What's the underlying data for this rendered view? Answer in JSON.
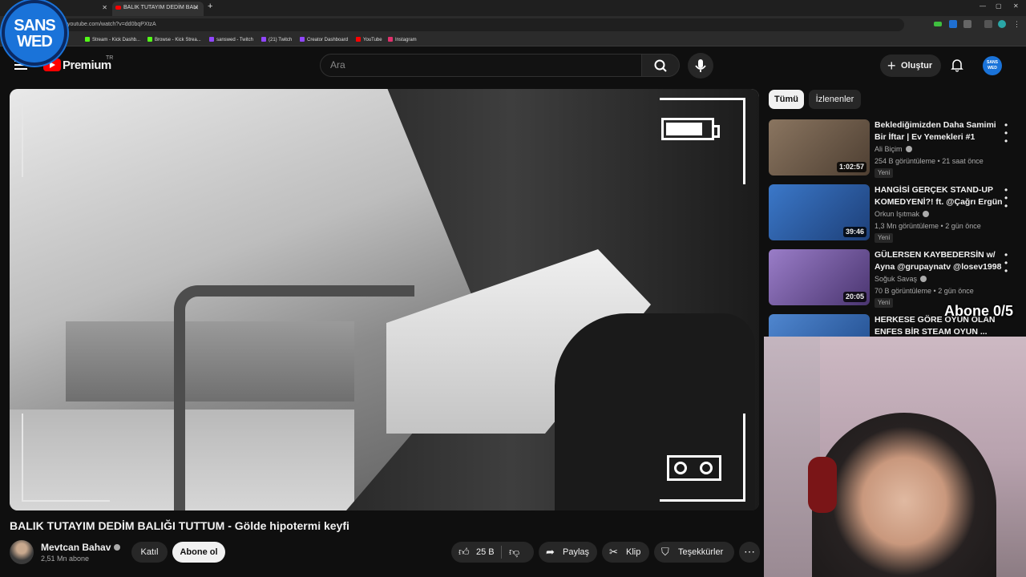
{
  "browser": {
    "tab1_label": "",
    "tab2_label": "BALIK TUTAYIM DEDİM BALI",
    "url": "youtube.com/watch?v=dd0bqPXtzA",
    "bookmarks": [
      {
        "label": "Stream - Kick Dashb...",
        "color": "#53fc18"
      },
      {
        "label": "Browse - Kick Strea...",
        "color": "#53fc18"
      },
      {
        "label": "sanswed - Twitch",
        "color": "#9146ff"
      },
      {
        "label": "(21) Twitch",
        "color": "#9146ff"
      },
      {
        "label": "Creator Dashboard",
        "color": "#9146ff"
      },
      {
        "label": "YouTube",
        "color": "#ff0000"
      },
      {
        "label": "Instagram",
        "color": "#e1306c"
      }
    ]
  },
  "logo": {
    "line1": "SANS",
    "line2": "WED"
  },
  "header": {
    "brand": "Premium",
    "region": "TR",
    "search_placeholder": "Ara",
    "create_label": "Oluştur",
    "avatar_text": "SANS WED"
  },
  "video": {
    "title": "BALIK TUTAYIM DEDİM BALIĞI TUTTUM - Gölde hipotermi keyfi",
    "channel": "Mevtcan Bahav",
    "subscribers": "2,51 Mn abone",
    "join_label": "Katıl",
    "subscribe_label": "Abone ol",
    "likes": "25 B",
    "share_label": "Paylaş",
    "clip_label": "Klip",
    "thanks_label": "Teşekkürler",
    "more_label": "⋯"
  },
  "sidebar": {
    "chips": [
      "Tümü",
      "İzlenenler"
    ],
    "recs": [
      {
        "title": "Beklediğimizden Daha Samimi Bir İftar | Ev Yemekleri #1",
        "channel": "Ali Biçim",
        "meta": "254 B görüntüleme • 21 saat önce",
        "badge": "Yeni",
        "duration": "1:02:57",
        "thumb_color": "#6b5a48"
      },
      {
        "title": "HANGİSİ GERÇEK STAND-UP KOMEDYENİ?! ft. @Çağrı Ergün",
        "channel": "Orkun Işıtmak",
        "meta": "1,3 Mn görüntüleme • 2 gün önce",
        "badge": "Yeni",
        "duration": "39:46",
        "thumb_color": "#2b5fa8"
      },
      {
        "title": "GÜLERSEN KAYBEDERSİN w/ Ayna @grupaynatv @losev1998",
        "channel": "Soğuk Savaş",
        "meta": "70 B görüntüleme • 2 gün önce",
        "badge": "Yeni",
        "duration": "20:05",
        "thumb_color": "#7a5ab0"
      },
      {
        "title": "HERKESE GÖRE OYUN OLAN ENFES BİR STEAM OYUN ...",
        "channel": "",
        "meta": "",
        "badge": "",
        "duration": "",
        "thumb_color": "#3a6fb5"
      }
    ]
  },
  "overlay": {
    "abone": "Abone 0/5"
  }
}
